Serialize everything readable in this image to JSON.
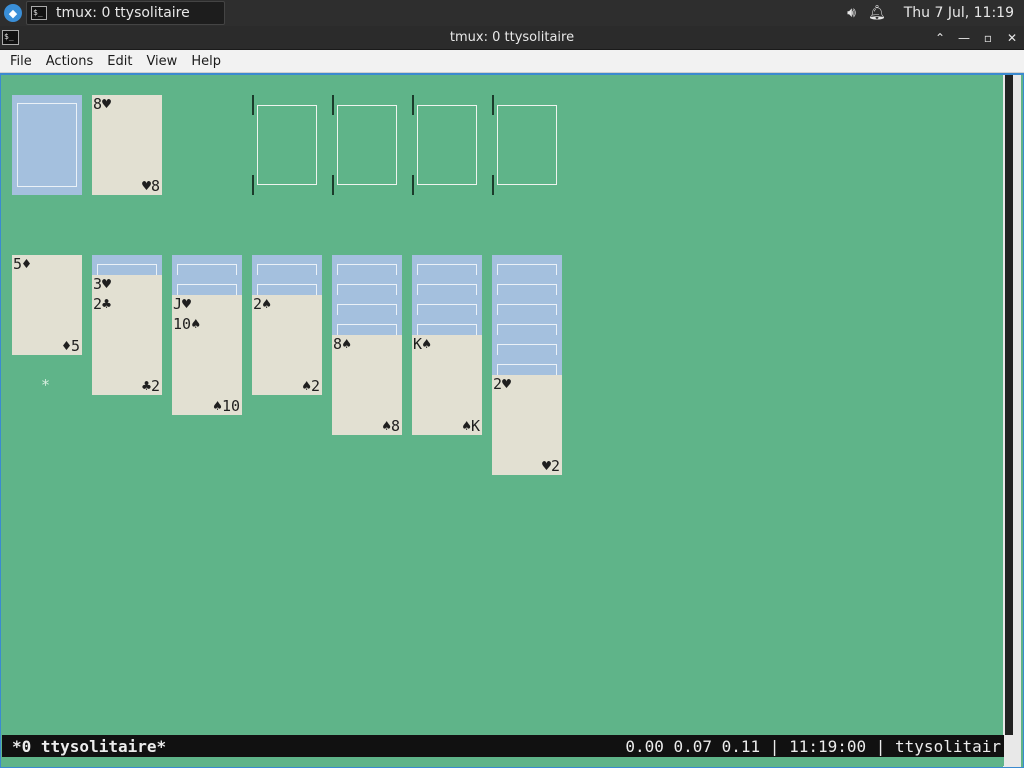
{
  "panel": {
    "taskbar_label": "tmux: 0 ttysolitaire",
    "clock": "Thu  7 Jul, 11:19"
  },
  "window": {
    "title": "tmux: 0 ttysolitaire"
  },
  "menu": [
    "File",
    "Actions",
    "Edit",
    "View",
    "Help"
  ],
  "game": {
    "waste": {
      "rank": "8",
      "suit": "♥"
    },
    "tableau": [
      {
        "face_down": 0,
        "cards": [
          {
            "rank": "5",
            "suit": "♦"
          }
        ]
      },
      {
        "face_down": 1,
        "cards": [
          {
            "rank": "3",
            "suit": "♥"
          },
          {
            "rank": "2",
            "suit": "♣"
          }
        ]
      },
      {
        "face_down": 2,
        "cards": [
          {
            "rank": "J",
            "suit": "♥"
          },
          {
            "rank": "10",
            "suit": "♠"
          }
        ]
      },
      {
        "face_down": 2,
        "cards": [
          {
            "rank": "2",
            "suit": "♠"
          }
        ]
      },
      {
        "face_down": 4,
        "cards": [
          {
            "rank": "8",
            "suit": "♠"
          }
        ]
      },
      {
        "face_down": 4,
        "cards": [
          {
            "rank": "K",
            "suit": "♠"
          }
        ]
      },
      {
        "face_down": 6,
        "cards": [
          {
            "rank": "2",
            "suit": "♥"
          }
        ]
      }
    ],
    "cursor": "*"
  },
  "status": {
    "left": "*0 ttysolitaire*",
    "right": "0.00 0.07 0.11 | 11:19:00 | ttysolitair"
  }
}
